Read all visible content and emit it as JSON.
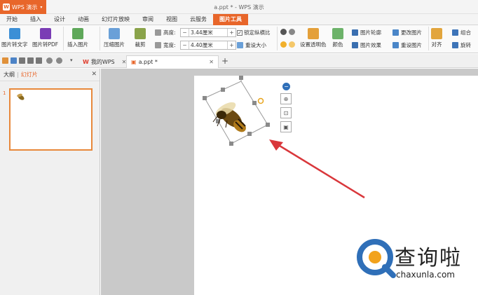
{
  "app": {
    "name": "WPS 演示",
    "window_title": "a.ppt * - WPS 演示",
    "logo_glyph": "W"
  },
  "ribbon_tabs": [
    "开始",
    "插入",
    "设计",
    "动画",
    "幻灯片放映",
    "审阅",
    "视图",
    "云服务",
    "图片工具"
  ],
  "ribbon": {
    "pic_to_text": "图片转文字",
    "pic_to_pdf": "图片转PDF",
    "insert_picture": "插入图片",
    "compress": "压缩图片",
    "crop": "裁剪",
    "height_label": "高度:",
    "height_value": "3.44厘米",
    "width_label": "宽度:",
    "width_value": "4.40厘米",
    "minus": "−",
    "plus": "+",
    "lock_ratio": "锁定纵横比",
    "reset_size": "重设大小",
    "set_transparent": "设置透明色",
    "color": "颜色",
    "pic_outline": "图片轮廓",
    "pic_effect": "图片效果",
    "change_pic": "更改图片",
    "reset_pic": "重设图片",
    "align": "对齐",
    "group": "组合",
    "rotate": "旋转",
    "dropdown": "▾"
  },
  "doc_tabs": [
    {
      "label": "我的WPS",
      "active": false
    },
    {
      "label": "a.ppt *",
      "active": true
    }
  ],
  "panel": {
    "outline_tab": "大纲",
    "slides_tab": "幻灯片",
    "slide_number": "1"
  },
  "watermark": {
    "brand": "查询啦",
    "url": "chaxunla.com"
  },
  "colors": {
    "accent": "#e8662a",
    "arrow": "#d9373b",
    "brand_blue": "#2f6fb8",
    "brand_orange": "#f2a21c"
  }
}
